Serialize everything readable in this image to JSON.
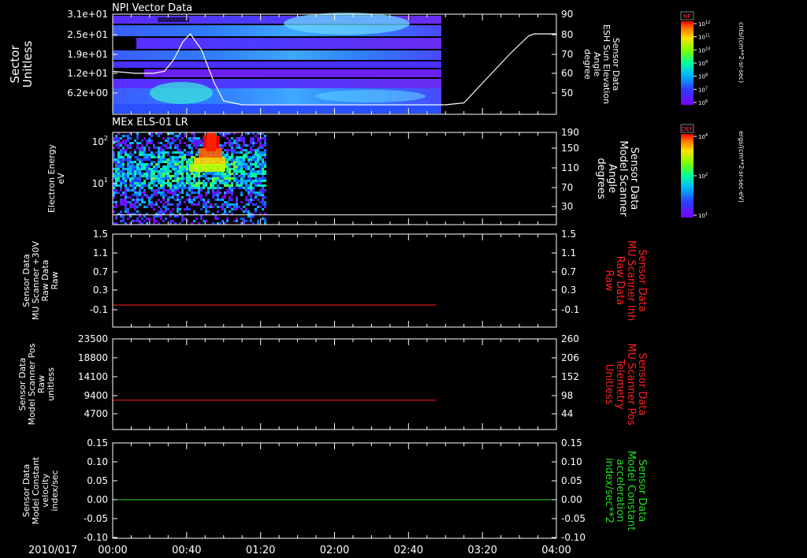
{
  "date_label": "2010/017",
  "x_tick_labels": [
    "00:00",
    "00:40",
    "01:20",
    "02:00",
    "02:40",
    "03:20",
    "04:00"
  ],
  "panels": [
    {
      "title": "NPI Vector Data",
      "left_label": [
        "Sector",
        "Unitless"
      ],
      "right_label": [
        "Sensor Data",
        "ESH Sun Elevation",
        "Angle",
        "degree"
      ],
      "right_label_color": "#ffffff",
      "left_ticks": [
        "3.1e+01",
        "2.5e+01",
        "1.9e+01",
        "1.2e+01",
        "6.2e+00"
      ],
      "right_ticks": [
        "90",
        "80",
        "70",
        "60",
        "50"
      ]
    },
    {
      "title": "MEx ELS-01 LR",
      "left_label": [
        "Electron Energy",
        "eV"
      ],
      "right_label": [
        "Sensor Data",
        "Model Scanner",
        "Angle",
        "degrees"
      ],
      "right_label_color": "#ffffff",
      "left_ticks": [
        "10",
        "10"
      ],
      "left_tick_exps": [
        "2",
        "1"
      ],
      "right_ticks": [
        "190",
        "150",
        "110",
        "70",
        "30"
      ]
    },
    {
      "title": "",
      "left_label": [
        "Sensor Data",
        "MU Scanner +30V",
        "Raw Data",
        "Raw"
      ],
      "right_label": [
        "Sensor Data",
        "MU Scanner Inh",
        "Raw Data",
        "Raw"
      ],
      "right_label_color": "#ff2020",
      "left_ticks": [
        "1.5",
        "1.1",
        "0.7",
        "0.3",
        "-0.1"
      ],
      "right_ticks": [
        "1.5",
        "1.1",
        "0.7",
        "0.3",
        "-0.1"
      ]
    },
    {
      "title": "",
      "left_label": [
        "Sensor Data",
        "Model Scanner Pos",
        "Raw",
        "unitless"
      ],
      "right_label": [
        "Sensor Data",
        "MU Scanner Pos",
        "Telemetry",
        "Unitless"
      ],
      "right_label_color": "#ff2020",
      "left_ticks": [
        "23500",
        "18800",
        "14100",
        "9400",
        "4700"
      ],
      "right_ticks": [
        "260",
        "206",
        "152",
        "98",
        "44"
      ]
    },
    {
      "title": "",
      "left_label": [
        "Sensor Data",
        "Model Constant",
        "velocity",
        "index/sec"
      ],
      "right_label": [
        "Sensor Data",
        "Model Constant",
        "acceleration",
        "index/sec**2"
      ],
      "right_label_color": "#20e020",
      "left_ticks": [
        "0.15",
        "0.10",
        "0.05",
        "0.00",
        "-0.05",
        "-0.10"
      ],
      "right_ticks": [
        "0.15",
        "0.10",
        "0.05",
        "0.00",
        "-0.05",
        "-0.10"
      ]
    }
  ],
  "colorbars": [
    {
      "title": "NF",
      "unit_label": "cnts/(cm**2-sr-sec)",
      "ticks": [
        "10",
        "10",
        "10",
        "10",
        "10",
        "10",
        "10"
      ],
      "tick_exps": [
        "12",
        "11",
        "10",
        "9",
        "8",
        "7",
        "6"
      ]
    },
    {
      "title": "DEF",
      "unit_label": "ergs/(cm**2-sr-sec-eV)",
      "ticks": [
        "10",
        "10",
        "10"
      ],
      "tick_exps": [
        "4",
        "2",
        "1"
      ]
    }
  ],
  "chart_data": [
    {
      "type": "heatmap",
      "title": "NPI Vector Data",
      "xlabel": "2010/017",
      "x_range": [
        "00:00",
        "04:00"
      ],
      "data_end": "02:52",
      "ylabel": "Sector Unitless",
      "yticks": [
        31,
        25,
        19,
        12,
        6.2
      ],
      "colorbar": "NF cnts/(cm**2-sr-sec)",
      "overlay_line": {
        "name": "Sensor Data ESH Sun Elevation Angle",
        "units": "degree",
        "ylim": [
          40,
          90
        ],
        "x": [
          "00:00",
          "00:12",
          "00:22",
          "00:28",
          "00:33",
          "00:38",
          "00:42",
          "00:48",
          "00:55",
          "01:00",
          "01:10",
          "02:00",
          "03:00",
          "03:10",
          "03:15",
          "03:25",
          "03:35",
          "03:45",
          "03:48",
          "04:00"
        ],
        "y": [
          61,
          60,
          60,
          61,
          67,
          76,
          80,
          72,
          55,
          46,
          44,
          44,
          44,
          45,
          50,
          60,
          70,
          79,
          80,
          80
        ]
      }
    },
    {
      "type": "heatmap",
      "title": "MEx ELS-01 LR",
      "xlabel": "2010/017",
      "x_range": [
        "00:00",
        "04:00"
      ],
      "data_end": "01:22",
      "ylabel": "Electron Energy eV",
      "y_scale": "log",
      "colorbar": "DEF ergs/(cm**2-sr-sec-eV)",
      "overlay_line": {
        "name": "Sensor Data Model Scanner Angle",
        "units": "degrees",
        "ylim": [
          10,
          190
        ],
        "x": [
          "00:00",
          "04:00"
        ],
        "y": [
          12,
          12
        ]
      }
    },
    {
      "type": "line",
      "ylim": [
        -0.3,
        1.5
      ],
      "series": [
        {
          "name": "Sensor Data MU Scanner Inh Raw Data Raw",
          "color": "#ff2020",
          "x": [
            "00:00",
            "02:55"
          ],
          "y": [
            0,
            0
          ]
        }
      ]
    },
    {
      "type": "line",
      "left_ylim": [
        0,
        23500
      ],
      "right_ylim": [
        0,
        260
      ],
      "series": [
        {
          "name": "Sensor Data MU Scanner Pos Telemetry Unitless",
          "color": "#ff2020",
          "x": [
            "00:00",
            "02:55"
          ],
          "y": [
            83,
            83
          ]
        }
      ]
    },
    {
      "type": "line",
      "ylim": [
        -0.1,
        0.15
      ],
      "series": [
        {
          "name": "Sensor Data Model Constant acceleration index/sec**2",
          "color": "#20e020",
          "x": [
            "00:00",
            "04:00"
          ],
          "y": [
            0,
            0
          ]
        }
      ]
    }
  ]
}
